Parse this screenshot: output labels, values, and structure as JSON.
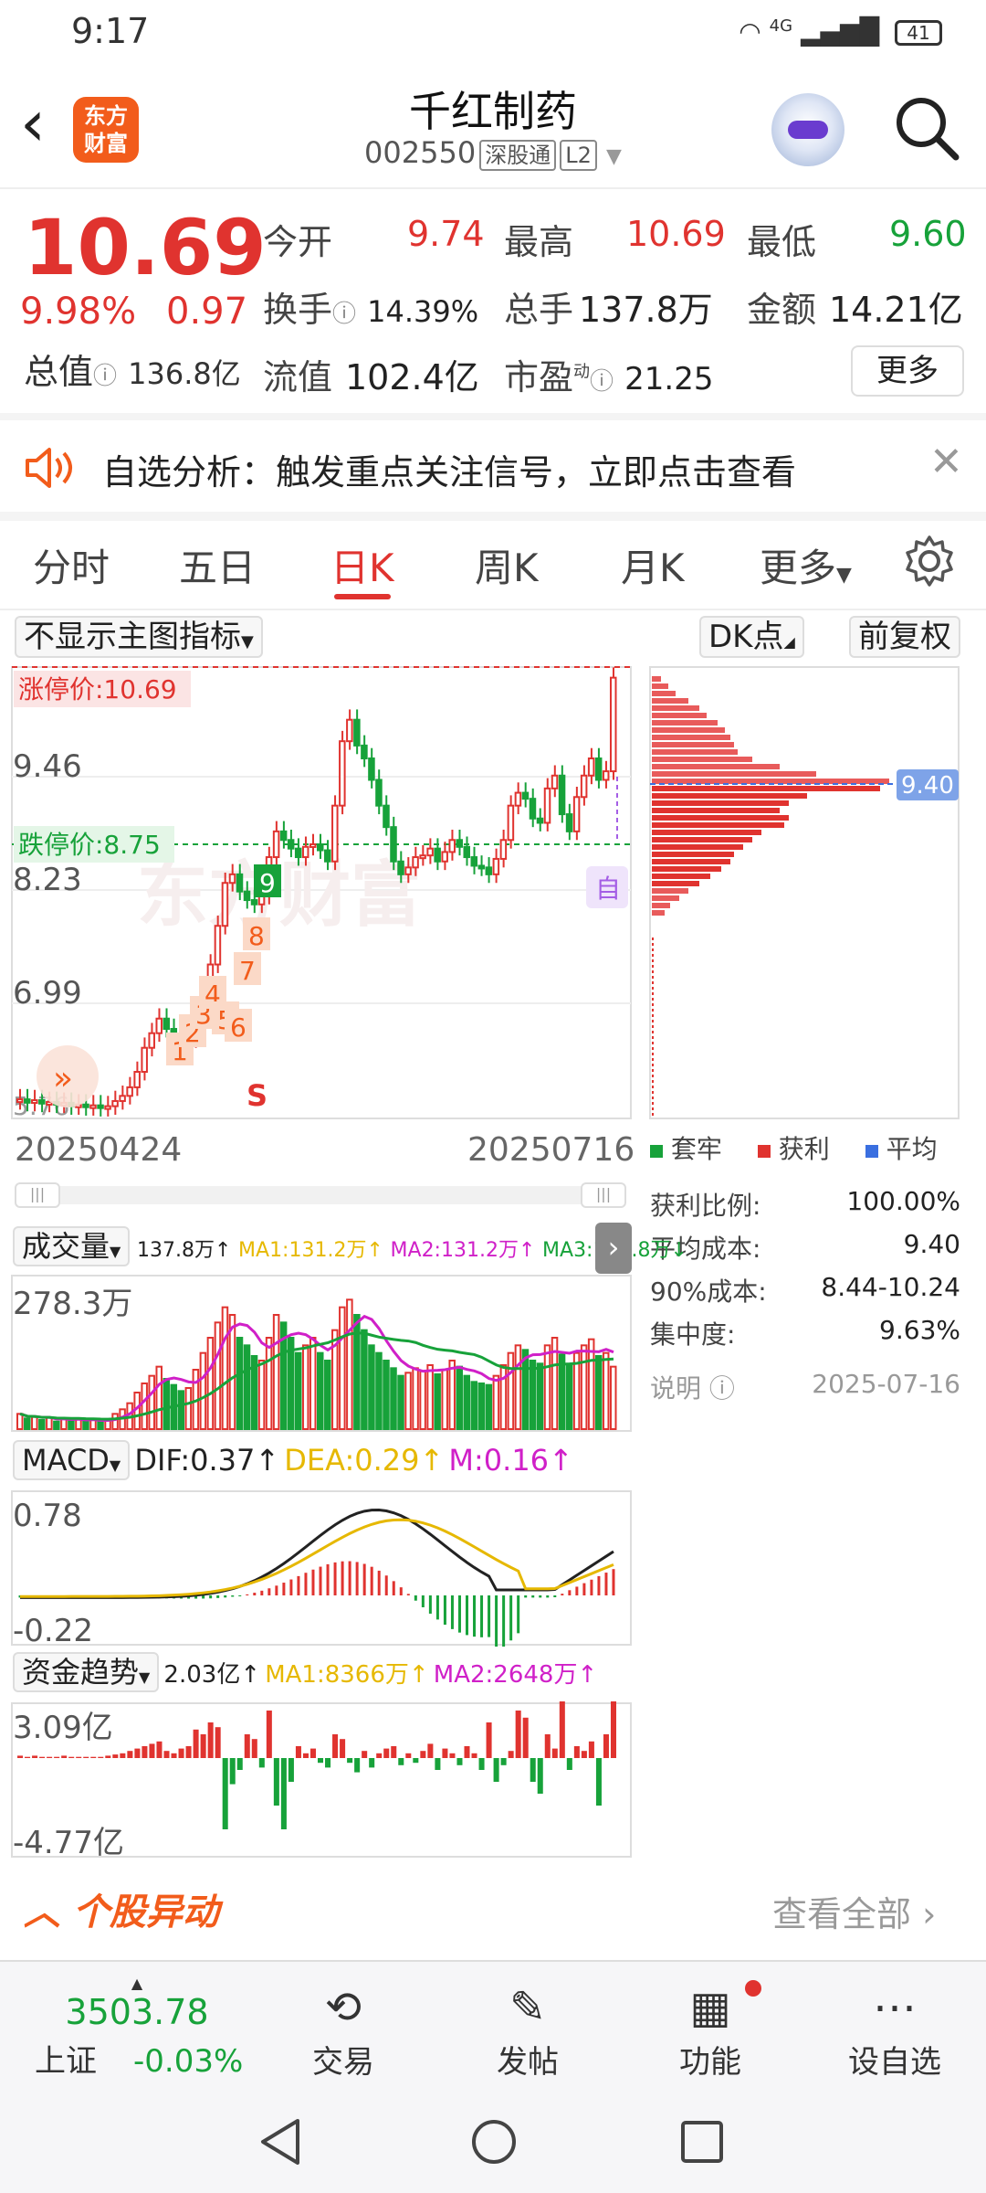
{
  "status": {
    "time": "9:17",
    "network": "4G",
    "battery": "41"
  },
  "header": {
    "stock_name": "千红制药",
    "stock_code": "002550",
    "tag1": "深股通",
    "tag2": "L2",
    "logo_line1": "东方",
    "logo_line2": "财富"
  },
  "quote": {
    "price": "10.69",
    "pct": "9.98%",
    "change": "0.97",
    "open_label": "今开",
    "open": "9.74",
    "high_label": "最高",
    "high": "10.69",
    "low_label": "最低",
    "low": "9.60",
    "turnover_label": "换手",
    "turnover": "14.39%",
    "volume_label": "总手",
    "volume": "137.8万",
    "amount_label": "金额",
    "amount": "14.21亿",
    "totalval_label": "总值",
    "totalval": "136.8亿",
    "floatval_label": "流值",
    "floatval": "102.4亿",
    "pe_label": "市盈",
    "pe_sup": "动",
    "pe": "21.25",
    "more_label": "更多"
  },
  "alert": {
    "text": "自选分析：触发重点关注信号，立即点击查看"
  },
  "tabs": [
    "分时",
    "五日",
    "日K",
    "周K",
    "月K",
    "更多"
  ],
  "active_tab": "日K",
  "chart_controls": {
    "indicator": "不显示主图指标",
    "dk": "DK点",
    "fq": "前复权"
  },
  "kline": {
    "limit_up": "涨停价:10.69",
    "limit_down": "跌停价:8.75",
    "y_labels": [
      "9.46",
      "8.23",
      "6.99",
      "5.76"
    ],
    "start_date": "20250424",
    "end_date": "20250716",
    "seq_marks": [
      "1",
      "2",
      "3",
      "4",
      "5",
      "6",
      "7",
      "8",
      "9"
    ],
    "s_mark": "S",
    "self_mark": "自",
    "watermark": "东方财富",
    "profile_price": "9.40"
  },
  "chip_legend": {
    "trapped": "套牢",
    "profit": "获利",
    "avg": "平均"
  },
  "chip_stats": [
    {
      "label": "获利比例:",
      "value": "100.00%"
    },
    {
      "label": "平均成本:",
      "value": "9.40"
    },
    {
      "label": "90%成本:",
      "value": "8.44-10.24"
    },
    {
      "label": "集中度:",
      "value": "9.63%"
    }
  ],
  "chip_note": {
    "label": "说明",
    "date": "2025-07-16"
  },
  "volume_panel": {
    "title": "成交量",
    "val": "137.8万↑",
    "ma1": "MA1:131.2万↑",
    "ma2": "MA2:131.2万↑",
    "ma3": "MA3:110.8万↓",
    "ymax": "278.3万"
  },
  "macd_panel": {
    "title": "MACD",
    "dif": "DIF:0.37↑",
    "dea": "DEA:0.29↑",
    "m": "M:0.16↑",
    "ymax": "0.78",
    "ymin": "-0.22"
  },
  "fund_panel": {
    "title": "资金趋势",
    "val": "2.03亿↑",
    "ma1": "MA1:8366万↑",
    "ma2": "MA2:2648万↑",
    "ymax": "3.09亿",
    "ymin": "-4.77亿"
  },
  "section": {
    "title": "个股异动",
    "link": "查看全部"
  },
  "bottom_nav": {
    "index_value": "3503.78",
    "index_name": "上证",
    "index_change": "-0.03%",
    "trade": "交易",
    "post": "发帖",
    "func": "功能",
    "watch": "设自选"
  },
  "colors": {
    "up": "#e0332f",
    "down": "#17a23a",
    "accent": "#f25c1b"
  }
}
